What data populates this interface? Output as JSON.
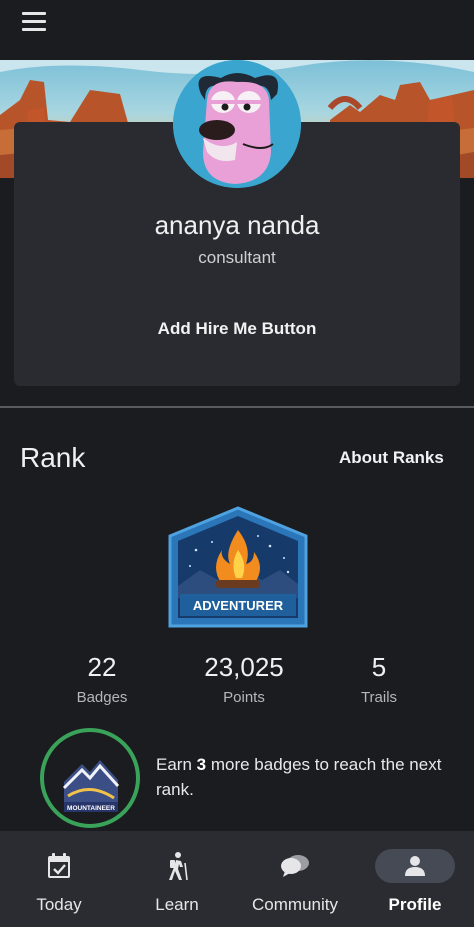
{
  "header": {
    "menu_icon": "hamburger-menu-icon"
  },
  "profile": {
    "name": "ananya nanda",
    "title": "consultant",
    "hire_button_label": "Add Hire Me Button"
  },
  "rank": {
    "heading": "Rank",
    "about_link": "About Ranks",
    "badge_name": "ADVENTURER",
    "stats": [
      {
        "value": "22",
        "label": "Badges"
      },
      {
        "value": "23,025",
        "label": "Points"
      },
      {
        "value": "5",
        "label": "Trails"
      }
    ],
    "next_rank": {
      "badge_name": "MOUNTAINEER",
      "text_before": "Earn ",
      "count": "3",
      "text_after": " more badges to reach the next rank."
    }
  },
  "nav": {
    "items": [
      {
        "label": "Today",
        "icon": "calendar-check-icon"
      },
      {
        "label": "Learn",
        "icon": "hiker-icon"
      },
      {
        "label": "Community",
        "icon": "chat-bubbles-icon"
      },
      {
        "label": "Profile",
        "icon": "person-icon"
      }
    ],
    "active": "Profile"
  },
  "colors": {
    "background": "#1b1c1f",
    "card": "#2a2b30",
    "progress_ring": "#3aa35a",
    "nav_active_pill": "#454a55",
    "badge_blue": "#1f5f9c"
  }
}
